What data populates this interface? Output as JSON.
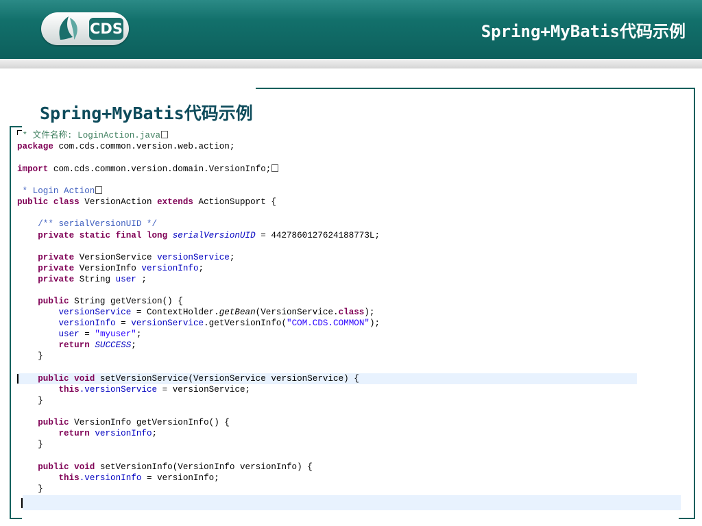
{
  "header": {
    "logo_text": "CDS",
    "title": "Spring+MyBatis代码示例"
  },
  "slide": {
    "title": "Spring+MyBatis代码示例"
  },
  "code": {
    "l1_comment": " * 文件名称: LoginAction.java",
    "l2_kw": "package",
    "l2_rest": " com.cds.common.version.web.action;",
    "l3_kw": "import",
    "l3_rest": " com.cds.common.version.domain.VersionInfo;",
    "l4_comment": " * Login Action",
    "l5_kw1": "public class",
    "l5_mid": " VersionAction ",
    "l5_kw2": "extends",
    "l5_rest": " ActionSupport {",
    "l6_comment": "    /** serialVersionUID */",
    "l7_kw": "    private static final long",
    "l7_field": "serialVersionUID",
    "l7_rest": " = 4427860127624188773L;",
    "l8_kw": "    private",
    "l8_type": " VersionService ",
    "l8_field": "versionService",
    "l8_end": ";",
    "l9_kw": "    private",
    "l9_type": " VersionInfo ",
    "l9_field": "versionInfo",
    "l9_end": ";",
    "l10_kw": "    private",
    "l10_type": " String ",
    "l10_field": "user",
    "l10_end": " ;",
    "l11_kw": "    public",
    "l11_rest": " String getVersion() {",
    "l12_field": "        versionService",
    "l12_mid": " = ContextHolder.",
    "l12_method": "getBean",
    "l12_mid2": "(VersionService.",
    "l12_kw": "class",
    "l12_end": ");",
    "l13_field": "        versionInfo",
    "l13_mid": " = ",
    "l13_field2": "versionService",
    "l13_mid2": ".getVersionInfo(",
    "l13_str": "\"COM.CDS.COMMON\"",
    "l13_end": ");",
    "l14_field": "        user",
    "l14_mid": " = ",
    "l14_str": "\"myuser\"",
    "l14_end": ";",
    "l15_kw": "        return",
    "l15_const": "SUCCESS",
    "l15_end": ";",
    "l16": "    }",
    "l17_kw": "    public void",
    "l17_rest": " setVersionService(VersionService versionService) {",
    "l18_kw": "        this",
    "l18_field": ".versionService",
    "l18_rest": " = versionService;",
    "l19": "    }",
    "l20_kw": "    public",
    "l20_rest": " VersionInfo getVersionInfo() {",
    "l21_kw": "        return",
    "l21_field": " versionInfo",
    "l21_end": ";",
    "l22": "    }",
    "l23_kw": "    public void",
    "l23_rest": " setVersionInfo(VersionInfo versionInfo) {",
    "l24_kw": "        this",
    "l24_field": ".versionInfo",
    "l24_rest": " = versionInfo;",
    "l25": "    }"
  },
  "colors": {
    "header_bg": "#0d5f5c",
    "title_color": "#0d4b5b",
    "keyword": "#7f0055",
    "javadoc": "#3f5fbf",
    "field": "#0000c0",
    "string": "#2a00ff",
    "line_highlight": "#e8f2fe"
  }
}
